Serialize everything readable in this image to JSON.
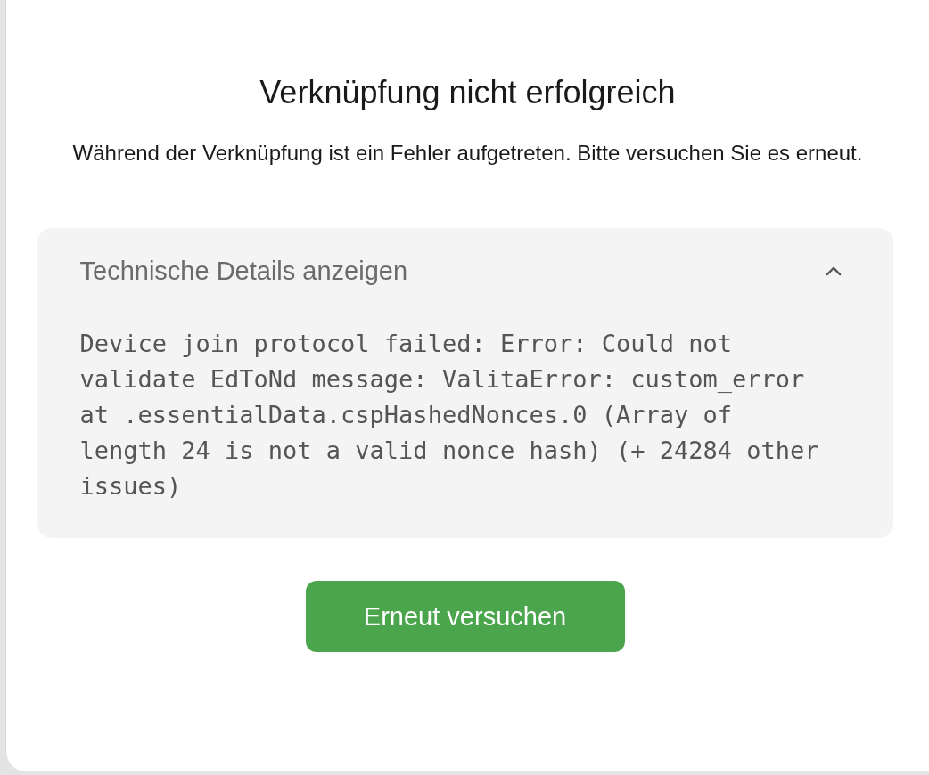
{
  "title": "Verknüpfung nicht erfolgreich",
  "message": "Während der Verknüpfung ist ein Fehler aufgetreten. Bitte versuchen Sie es erneut.",
  "details": {
    "label": "Technische Details anzeigen",
    "expanded": true,
    "text": "Device join protocol failed: Error: Could not validate EdToNd message: ValitaError: custom_error at .essentialData.cspHashedNonces.0 (Array of length 24 is not a valid nonce hash) (+ 24284 other issues)"
  },
  "button": "Erneut versuchen"
}
